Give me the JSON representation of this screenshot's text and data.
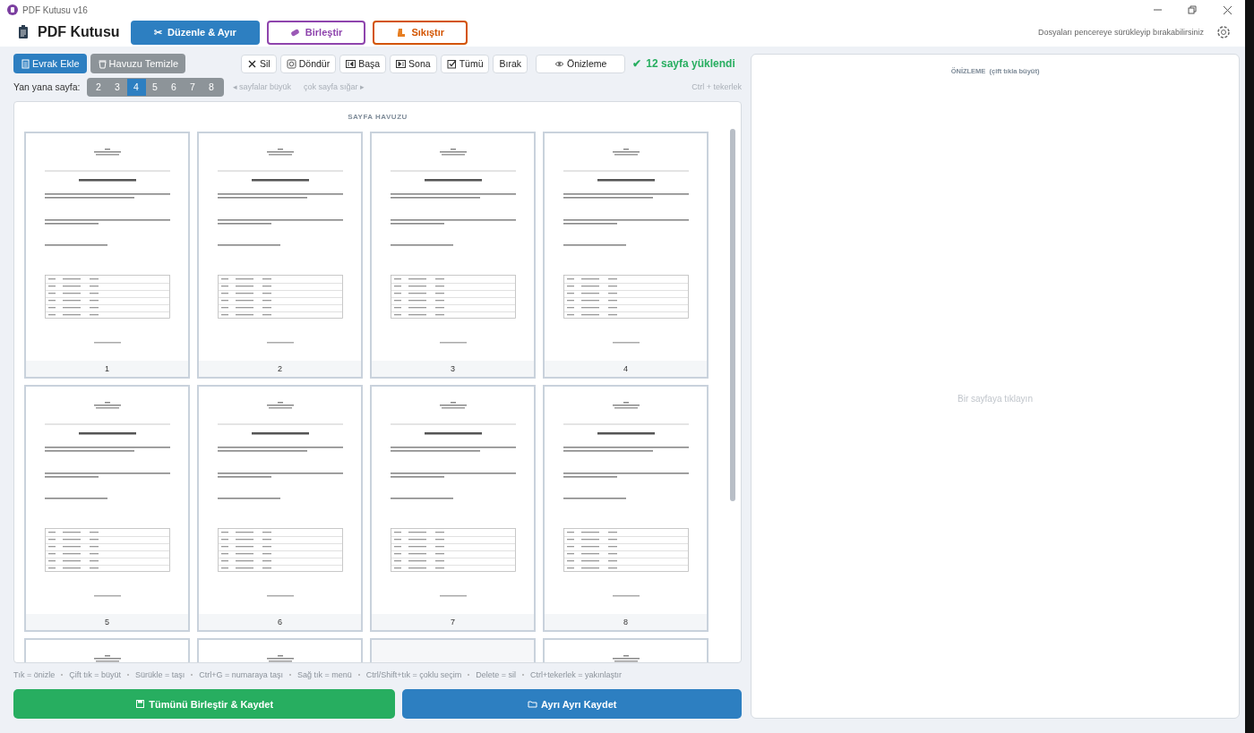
{
  "window": {
    "title": "PDF Kutusu v16"
  },
  "header": {
    "app_name": "PDF Kutusu",
    "hint": "Dosyaları pencereye sürükleyip bırakabilirsiniz",
    "mode_tabs": [
      {
        "label": "Düzenle & Ayır",
        "icon": "✂",
        "selected": true,
        "color": "#2d7fc1"
      },
      {
        "label": "Birleştir",
        "kind": "eraser",
        "selected": false,
        "color": "#8e44ad"
      },
      {
        "label": "Sıkıştır",
        "kind": "boot",
        "selected": false,
        "color": "#d35400"
      }
    ]
  },
  "toolbar": {
    "file_buttons": [
      {
        "label": "Evrak Ekle",
        "kind": "add"
      },
      {
        "label": "Havuzu Temizle",
        "kind": "clear"
      }
    ],
    "actions": [
      {
        "label": "Sil",
        "kind": "delete"
      },
      {
        "label": "Döndür",
        "kind": "rotate"
      },
      {
        "label": "Başa",
        "kind": "first"
      },
      {
        "label": "Sona",
        "kind": "last"
      },
      {
        "label": "Tümü",
        "kind": "all"
      },
      {
        "label": "Bırak",
        "kind": "plain"
      },
      {
        "label": "Önizleme",
        "kind": "preview"
      }
    ],
    "status": {
      "icon": "✔",
      "text": "12 sayfa yüklendi"
    }
  },
  "columns": {
    "label": "Yan yana sayfa:",
    "hint_left": "◂ sayfalar büyük",
    "hint_right": "çok sayfa sığar ▸",
    "zoom_hint": "Ctrl + tekerlek",
    "options": [
      {
        "label": "2",
        "selected": false
      },
      {
        "label": "3",
        "selected": false
      },
      {
        "label": "4",
        "selected": true
      },
      {
        "label": "5",
        "selected": false
      },
      {
        "label": "6",
        "selected": false
      },
      {
        "label": "7",
        "selected": false
      },
      {
        "label": "8",
        "selected": false
      }
    ]
  },
  "pool": {
    "title": "SAYFA HAVUZU",
    "pages": [
      {
        "number": "1",
        "loading": false
      },
      {
        "number": "2",
        "loading": false
      },
      {
        "number": "3",
        "loading": false
      },
      {
        "number": "4",
        "loading": false
      },
      {
        "number": "5",
        "loading": false
      },
      {
        "number": "6",
        "loading": false
      },
      {
        "number": "7",
        "loading": false
      },
      {
        "number": "8",
        "loading": false
      },
      {
        "loading": false
      },
      {
        "loading": false
      },
      {
        "loading": true
      },
      {
        "loading": false
      }
    ]
  },
  "shortcuts": [
    "Tık = önizle",
    "Çift tık = büyüt",
    "Sürükle = taşı",
    "Ctrl+G = numaraya taşı",
    "Sağ tık = menü",
    "Ctrl/Shift+tık = çoklu seçim",
    "Delete = sil",
    "Ctrl+tekerlek = yakınlaştır"
  ],
  "save_buttons": [
    {
      "label": "Tümünü Birleştir & Kaydet",
      "kind": "merge"
    },
    {
      "label": "Ayrı Ayrı Kaydet",
      "kind": "split"
    }
  ],
  "preview": {
    "title": "ÖNİZLEME  (çift tıkla büyüt)",
    "empty": "Bir sayfaya tıklayın"
  }
}
